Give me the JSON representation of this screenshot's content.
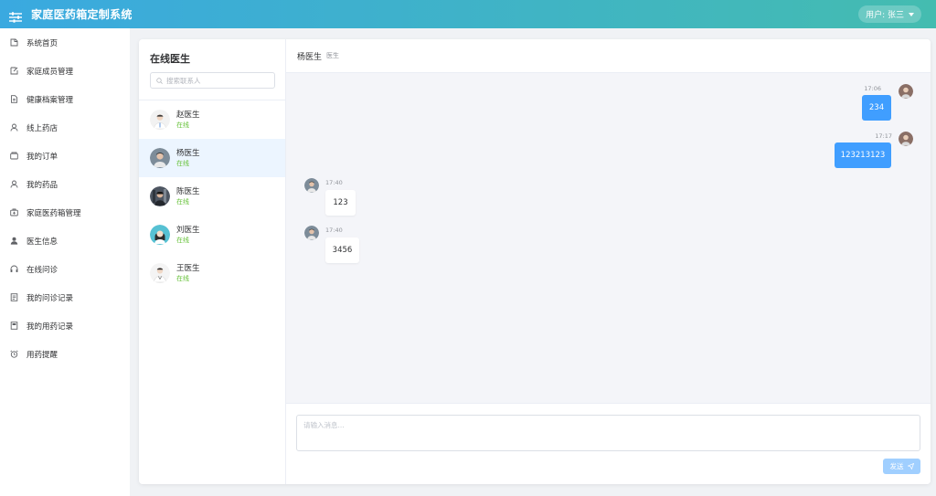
{
  "header": {
    "title": "家庭医药箱定制系统",
    "user_label": "用户: 张三"
  },
  "sidebar": {
    "items": [
      {
        "label": "系统首页",
        "icon": "home-icon"
      },
      {
        "label": "家庭成员管理",
        "icon": "edit-icon"
      },
      {
        "label": "健康档案管理",
        "icon": "document-icon"
      },
      {
        "label": "线上药店",
        "icon": "user-icon"
      },
      {
        "label": "我的订单",
        "icon": "wallet-icon"
      },
      {
        "label": "我的药品",
        "icon": "user-outline-icon"
      },
      {
        "label": "家庭医药箱管理",
        "icon": "medical-box-icon"
      },
      {
        "label": "医生信息",
        "icon": "user-solid-icon"
      },
      {
        "label": "在线问诊",
        "icon": "headset-icon"
      },
      {
        "label": "我的问诊记录",
        "icon": "tickets-icon"
      },
      {
        "label": "我的用药记录",
        "icon": "notebook-icon"
      },
      {
        "label": "用药提醒",
        "icon": "alarm-clock-icon"
      }
    ]
  },
  "contacts": {
    "title": "在线医生",
    "search_placeholder": "搜索联系人",
    "list": [
      {
        "name": "赵医生",
        "status": "在线"
      },
      {
        "name": "杨医生",
        "status": "在线"
      },
      {
        "name": "陈医生",
        "status": "在线"
      },
      {
        "name": "刘医生",
        "status": "在线"
      },
      {
        "name": "王医生",
        "status": "在线"
      }
    ]
  },
  "chat": {
    "doctor_name": "杨医生",
    "doctor_role": "医生",
    "messages": [
      {
        "from": "me",
        "time": "17:06",
        "text": "234"
      },
      {
        "from": "me",
        "time": "17:17",
        "text": "123213123"
      },
      {
        "from": "doctor",
        "time": "17:40",
        "text": "123"
      },
      {
        "from": "doctor",
        "time": "17:40",
        "text": "3456"
      }
    ],
    "input_placeholder": "请输入消息...",
    "send_label": "发送"
  },
  "colors": {
    "header_start": "#3aa9e0",
    "header_end": "#44bcb0",
    "primary": "#409eff",
    "send_disabled": "#a0cfff",
    "online": "#67c23a",
    "active_contact": "#ecf5ff"
  }
}
